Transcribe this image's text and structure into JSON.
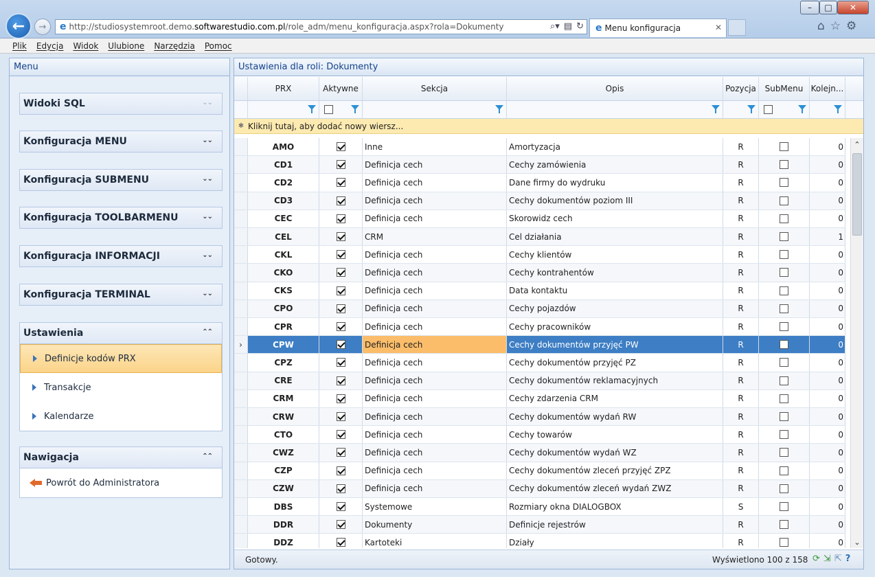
{
  "browser": {
    "url_prefix": "http://studiosystemroot.demo.",
    "url_domain": "softwarestudio.com.pl",
    "url_suffix": "/role_adm/menu_konfiguracja.aspx?rola=Dokumenty",
    "tab_title": "Menu konfiguracja",
    "menu": [
      "Plik",
      "Edycja",
      "Widok",
      "Ulubione",
      "Narzędzia",
      "Pomoc"
    ]
  },
  "left_panel": {
    "title": "Menu",
    "sections": [
      {
        "label": "Widoki SQL"
      },
      {
        "label": "Konfiguracja MENU"
      },
      {
        "label": "Konfiguracja SUBMENU"
      },
      {
        "label": "Konfiguracja TOOLBARMENU"
      },
      {
        "label": "Konfiguracja INFORMACJI"
      },
      {
        "label": "Konfiguracja TERMINAL"
      }
    ],
    "ustawienia": {
      "label": "Ustawienia",
      "items": [
        "Definicje kodów PRX",
        "Transakcje",
        "Kalendarze"
      ]
    },
    "nawigacja": {
      "label": "Nawigacja",
      "items": [
        "Powrót do Administratora"
      ]
    }
  },
  "grid": {
    "title": "Ustawienia dla roli: Dokumenty",
    "columns": [
      "PRX",
      "Aktywne",
      "Sekcja",
      "Opis",
      "Pozycja",
      "SubMenu",
      "Kolejn..."
    ],
    "new_row_text": "Kliknij tutaj, aby dodać nowy wiersz...",
    "rows": [
      {
        "prx": "AMO",
        "aktywne": true,
        "sekcja": "Inne",
        "opis": "Amortyzacja",
        "pozycja": "R",
        "submenu": false,
        "kolejnosc": "0"
      },
      {
        "prx": "CD1",
        "aktywne": true,
        "sekcja": "Definicja cech",
        "opis": "Cechy zamówienia",
        "pozycja": "R",
        "submenu": false,
        "kolejnosc": "0"
      },
      {
        "prx": "CD2",
        "aktywne": true,
        "sekcja": "Definicja cech",
        "opis": "Dane firmy do wydruku",
        "pozycja": "R",
        "submenu": false,
        "kolejnosc": "0"
      },
      {
        "prx": "CD3",
        "aktywne": true,
        "sekcja": "Definicja cech",
        "opis": "Cechy dokumentów poziom III",
        "pozycja": "R",
        "submenu": false,
        "kolejnosc": "0"
      },
      {
        "prx": "CEC",
        "aktywne": true,
        "sekcja": "Definicja cech",
        "opis": "Skorowidz cech",
        "pozycja": "R",
        "submenu": false,
        "kolejnosc": "0"
      },
      {
        "prx": "CEL",
        "aktywne": true,
        "sekcja": "CRM",
        "opis": "Cel działania",
        "pozycja": "R",
        "submenu": false,
        "kolejnosc": "1"
      },
      {
        "prx": "CKL",
        "aktywne": true,
        "sekcja": "Definicja cech",
        "opis": "Cechy klientów",
        "pozycja": "R",
        "submenu": false,
        "kolejnosc": "0"
      },
      {
        "prx": "CKO",
        "aktywne": true,
        "sekcja": "Definicja cech",
        "opis": "Cechy kontrahentów",
        "pozycja": "R",
        "submenu": false,
        "kolejnosc": "0"
      },
      {
        "prx": "CKS",
        "aktywne": true,
        "sekcja": "Definicja cech",
        "opis": "Data kontaktu",
        "pozycja": "R",
        "submenu": false,
        "kolejnosc": "0"
      },
      {
        "prx": "CPO",
        "aktywne": true,
        "sekcja": "Definicja cech",
        "opis": "Cechy pojazdów",
        "pozycja": "R",
        "submenu": false,
        "kolejnosc": "0"
      },
      {
        "prx": "CPR",
        "aktywne": true,
        "sekcja": "Definicja cech",
        "opis": "Cechy pracowników",
        "pozycja": "R",
        "submenu": false,
        "kolejnosc": "0"
      },
      {
        "prx": "CPW",
        "aktywne": true,
        "sekcja": "Definicja cech",
        "opis": "Cechy dokumentów przyjęć PW",
        "pozycja": "R",
        "submenu": false,
        "kolejnosc": "0",
        "selected": true
      },
      {
        "prx": "CPZ",
        "aktywne": true,
        "sekcja": "Definicja cech",
        "opis": "Cechy dokumentów przyjęć PZ",
        "pozycja": "R",
        "submenu": false,
        "kolejnosc": "0"
      },
      {
        "prx": "CRE",
        "aktywne": true,
        "sekcja": "Definicja cech",
        "opis": "Cechy dokumentów reklamacyjnych",
        "pozycja": "R",
        "submenu": false,
        "kolejnosc": "0"
      },
      {
        "prx": "CRM",
        "aktywne": true,
        "sekcja": "Definicja cech",
        "opis": "Cechy zdarzenia CRM",
        "pozycja": "R",
        "submenu": false,
        "kolejnosc": "0"
      },
      {
        "prx": "CRW",
        "aktywne": true,
        "sekcja": "Definicja cech",
        "opis": "Cechy dokumentów wydań RW",
        "pozycja": "R",
        "submenu": false,
        "kolejnosc": "0"
      },
      {
        "prx": "CTO",
        "aktywne": true,
        "sekcja": "Definicja cech",
        "opis": "Cechy towarów",
        "pozycja": "R",
        "submenu": false,
        "kolejnosc": "0"
      },
      {
        "prx": "CWZ",
        "aktywne": true,
        "sekcja": "Definicja cech",
        "opis": "Cechy dokumentów wydań WZ",
        "pozycja": "R",
        "submenu": false,
        "kolejnosc": "0"
      },
      {
        "prx": "CZP",
        "aktywne": true,
        "sekcja": "Definicja cech",
        "opis": "Cechy dokumentów zleceń przyjęć ZPZ",
        "pozycja": "R",
        "submenu": false,
        "kolejnosc": "0"
      },
      {
        "prx": "CZW",
        "aktywne": true,
        "sekcja": "Definicja cech",
        "opis": "Cechy dokumentów zleceń wydań ZWZ",
        "pozycja": "R",
        "submenu": false,
        "kolejnosc": "0"
      },
      {
        "prx": "DBS",
        "aktywne": true,
        "sekcja": "Systemowe",
        "opis": "Rozmiary okna DIALOGBOX",
        "pozycja": "S",
        "submenu": false,
        "kolejnosc": "0"
      },
      {
        "prx": "DDR",
        "aktywne": true,
        "sekcja": "Dokumenty",
        "opis": "Definicje rejestrów",
        "pozycja": "R",
        "submenu": false,
        "kolejnosc": "0"
      },
      {
        "prx": "DDZ",
        "aktywne": true,
        "sekcja": "Kartoteki",
        "opis": "Działy",
        "pozycja": "R",
        "submenu": false,
        "kolejnosc": "0"
      }
    ],
    "status_left": "Gotowy.",
    "status_right": "Wyświetlono 100 z 158"
  }
}
